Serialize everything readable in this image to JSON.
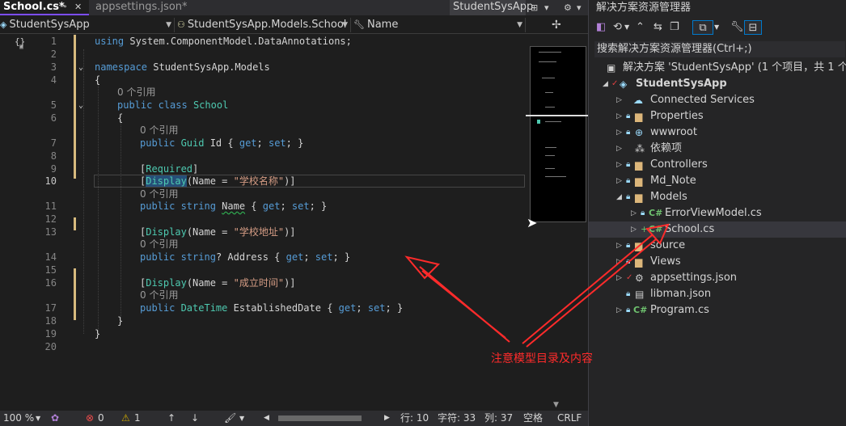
{
  "tabs": {
    "active": "School.cs*",
    "second": "appsettings.json*",
    "preview": "StudentSysApp"
  },
  "navbar": {
    "project": "StudentSysApp",
    "class": "StudentSysApp.Models.School",
    "member": "Name"
  },
  "code": {
    "line_numbers": [
      "1",
      "2",
      "3",
      "4",
      "5",
      "6",
      "7",
      "8",
      "9",
      "10",
      "11",
      "12",
      "13",
      "14",
      "15",
      "16",
      "17",
      "18",
      "19",
      "20"
    ],
    "current_line": "10",
    "ref_text": "0 个引用",
    "l1_using": "using",
    "l1_ns": " System.ComponentModel.DataAnnotations;",
    "l3_namespace": "namespace",
    "l3_name": " StudentSysApp.Models",
    "l4": "{",
    "l5_public": "public",
    "l5_class": " class",
    "l5_name": " School",
    "l6": "{",
    "l7_public": "public",
    "l7_type": " Guid",
    "l7_rest_a": " Id { ",
    "l7_get": "get",
    "l7_rest_b": "; ",
    "l7_set": "set",
    "l7_rest_c": "; }",
    "l9_attr_open": "[",
    "l9_attr": "Required",
    "l9_attr_close": "]",
    "l10_open": "[",
    "l10_attr": "Display",
    "l10_mid": "(Name = ",
    "l10_str": "\"学校名称\"",
    "l10_close": ")]",
    "l11_public": "public",
    "l11_type": " string",
    "l11_sp": " ",
    "l11_name": "Name",
    "l11_rest_a": " { ",
    "l11_get": "get",
    "l11_rest_b": "; ",
    "l11_set": "set",
    "l11_rest_c": "; }",
    "l13_open": "[",
    "l13_attr": "Display",
    "l13_mid": "(Name = ",
    "l13_str": "\"学校地址\"",
    "l13_close": ")]",
    "l14_public": "public",
    "l14_type": " string",
    "l14_rest_a": "? Address { ",
    "l14_get": "get",
    "l14_rest_b": "; ",
    "l14_set": "set",
    "l14_rest_c": "; }",
    "l16_open": "[",
    "l16_attr": "Display",
    "l16_mid": "(Name = ",
    "l16_str": "\"成立时间\"",
    "l16_close": ")]",
    "l17_public": "public",
    "l17_type": " DateTime",
    "l17_rest_a": " EstablishedDate { ",
    "l17_get": "get",
    "l17_rest_b": "; ",
    "l17_set": "set",
    "l17_rest_c": "; }",
    "l18": "}",
    "l19": "}"
  },
  "statusbar": {
    "zoom": "100 %",
    "errors": "0",
    "warnings": "1",
    "line": "行: 10",
    "char": "字符: 33",
    "col": "列: 37",
    "spaces": "空格",
    "eol": "CRLF"
  },
  "explorer": {
    "title": "解决方案资源管理器",
    "search": "搜索解决方案资源管理器(Ctrl+;)",
    "items": [
      {
        "label": "解决方案 'StudentSysApp' (1 个项目，共 1 个)",
        "icon": "solution-icon"
      },
      {
        "label": "StudentSysApp",
        "icon": "csharp-project-icon"
      },
      {
        "label": "Connected Services",
        "icon": "connected-services-icon"
      },
      {
        "label": "Properties",
        "icon": "folder-icon"
      },
      {
        "label": "wwwroot",
        "icon": "globe-icon"
      },
      {
        "label": "依赖项",
        "icon": "dependencies-icon"
      },
      {
        "label": "Controllers",
        "icon": "folder-icon"
      },
      {
        "label": "Md_Note",
        "icon": "folder-icon"
      },
      {
        "label": "Models",
        "icon": "folder-icon"
      },
      {
        "label": "ErrorViewModel.cs",
        "icon": "csharp-file-icon"
      },
      {
        "label": "School.cs",
        "icon": "csharp-file-icon"
      },
      {
        "label": "source",
        "icon": "folder-icon"
      },
      {
        "label": "Views",
        "icon": "folder-icon"
      },
      {
        "label": "appsettings.json",
        "icon": "json-file-icon"
      },
      {
        "label": "libman.json",
        "icon": "json-file-icon"
      },
      {
        "label": "Program.cs",
        "icon": "csharp-file-icon"
      }
    ]
  },
  "annotation": {
    "text": "注意模型目录及内容",
    "color": "#ff2b2b"
  },
  "colors": {
    "accent": "#7c4dff",
    "keyword": "#569cd6",
    "type": "#4ec9b0",
    "string": "#d69d85",
    "change_marker": "#d7ba7d"
  }
}
